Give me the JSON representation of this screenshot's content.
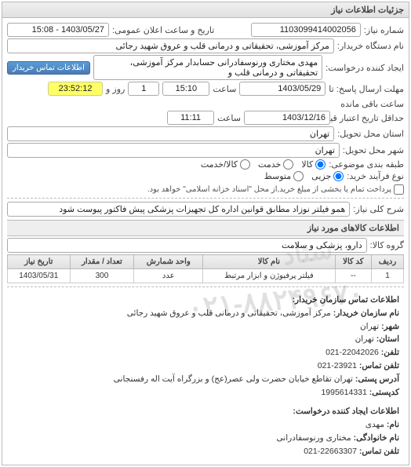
{
  "panel_title": "جزئیات اطلاعات نیاز",
  "labels": {
    "need_no": "شماره نیاز:",
    "announce_dt": "تاریخ و ساعت اعلان عمومی:",
    "buyer_org": "نام دستگاه خریدار:",
    "requester": "ایجاد کننده درخواست:",
    "reply_deadline": "مهلت ارسال پاسخ: تا",
    "time": "ساعت",
    "days_remaining_suffix": "روز و",
    "remaining_suffix": "ساعت باقی مانده",
    "price_valid": "حداقل تاریخ اعتبار قیمت: تا تاریخ:",
    "delivery_province": "استان محل تحویل:",
    "delivery_city": "شهر محل تحویل:",
    "category": "طبقه بندی موضوعی:",
    "process_type": "نوع فرآیند خرید:",
    "need_desc": "شرح کلی نیاز:",
    "goods_info": "اطلاعات کالاهای مورد نیاز",
    "goods_group": "گروه کالا:",
    "contact_info_title": "اطلاعات تماس سازمان خریدار:",
    "org_name": "نام سازمان خریدار:",
    "city": "شهر:",
    "province": "استان:",
    "phone": "تلفن:",
    "fax": "تلفن تماس:",
    "postal_addr": "آدرس پستی:",
    "postal_code": "کدپستی:",
    "requester_info_title": "اطلاعات ایجاد کننده درخواست:",
    "fname": "نام:",
    "lname": "نام خانوادگی:",
    "contact_phone": "تلفن تماس:",
    "contact_btn": "اطلاعات تماس خریدار"
  },
  "fields": {
    "need_no": "1103099414002056",
    "announce_dt": "1403/05/27 - 15:08",
    "buyer_org": "مرکز آموزشی، تحقیقاتی و درمانی قلب و عروق شهید رجائی",
    "requester": "مهدی مختاری ورنوسفادرانی حسابدار مرکز آموزشی، تحقیقاتی و درمانی قلب و",
    "reply_date": "1403/05/29",
    "reply_time": "15:10",
    "days_remaining": "1",
    "countdown": "23:52:12",
    "price_valid_date": "1403/12/16",
    "price_valid_time": "11:11",
    "delivery_province": "تهران",
    "delivery_city": "تهران",
    "need_desc": "همو فیلتر نوزاد مطابق قوانین اداره کل تجهیزات پزشکی پیش فاکتور پیوست شود",
    "goods_group": "دارو، پزشکی و سلامت"
  },
  "radios": {
    "cat_goods": "کالا",
    "cat_service": "خدمت",
    "cat_both": "کالا/خدمت",
    "proc_low": "جزیی",
    "proc_mid": "متوسط"
  },
  "proc_note": "پرداخت تمام یا بخشی از مبلغ خرید,از محل \"اسناد خزانه اسلامی\" خواهد بود.",
  "table": {
    "headers": {
      "row": "ردیف",
      "code": "کد کالا",
      "name": "نام کالا",
      "unit": "واحد شمارش",
      "qty": "تعداد / مقدار",
      "date": "تاریخ نیاز"
    },
    "rows": [
      {
        "row": "1",
        "code": "--",
        "name": "فیلتر پرفیوژن و ابزار مرتبط",
        "unit": "عدد",
        "qty": "300",
        "date": "1403/05/31"
      }
    ]
  },
  "footer": {
    "org_name": "مرکز آموزشی، تحقیقاتی و درمانی قلب و عروق شهید رجائی",
    "city": "تهران",
    "province": "تهران",
    "phone": "22042026-021",
    "fax": "23921-021",
    "postal_addr": "تهران تقاطع خیابان حضرت ولی عصر(عج) و بزرگراه آیت اله رفسنجانی",
    "postal_code": "1995614331",
    "req_fname": "مهدی",
    "req_lname": "مختاری ورنوسفادرانی",
    "req_phone": "22663307-021"
  },
  "watermark1": "ستاد",
  "watermark2": "۰۲۱-۸۸۲۴۹۶۷۰"
}
